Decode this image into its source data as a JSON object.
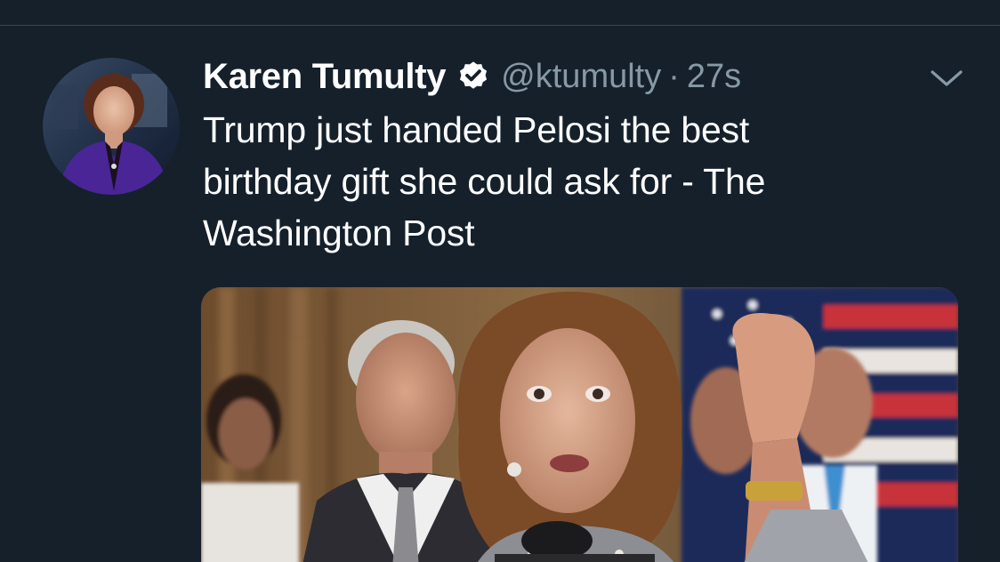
{
  "tweet": {
    "author_name": "Karen Tumulty",
    "handle": "@ktumulty",
    "separator": "·",
    "time": "27s",
    "text_lines": [
      "Trump just handed Pelosi the best",
      "birthday gift she could ask for - The",
      "Washington Post"
    ]
  },
  "icons": {
    "verified": "verified-badge-icon",
    "caret": "chevron-down-icon"
  },
  "colors": {
    "background": "#15202b",
    "divider": "#38444d",
    "secondary_text": "#8899a6",
    "primary_text": "#ffffff"
  }
}
